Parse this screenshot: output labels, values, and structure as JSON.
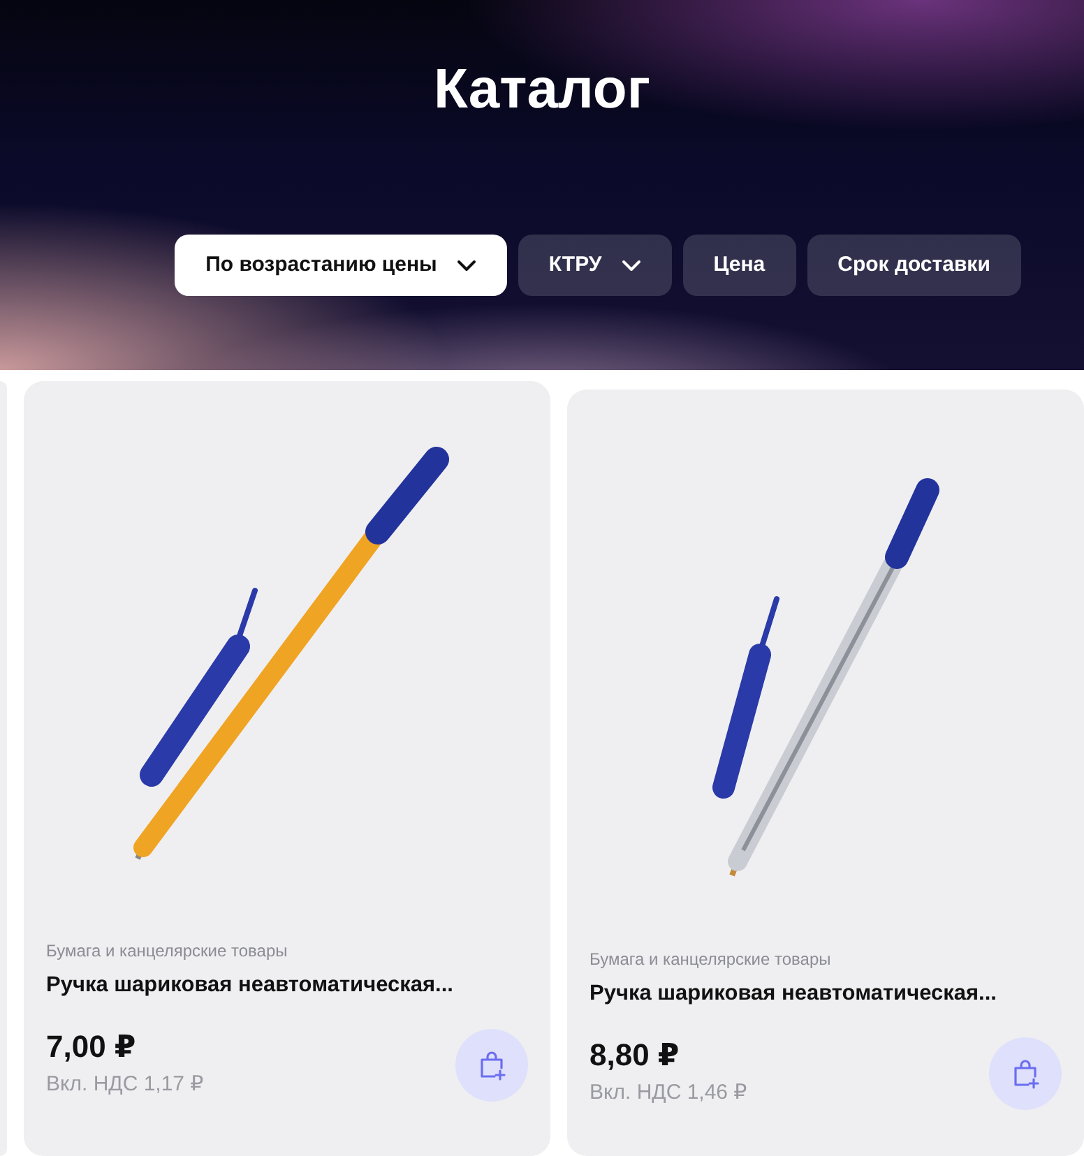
{
  "header": {
    "title": "Каталог"
  },
  "filters": [
    {
      "kind": "sort",
      "label": "По возрастанию цены",
      "has_dropdown": true
    },
    {
      "kind": "filter",
      "label": "КТРУ",
      "has_dropdown": true
    },
    {
      "kind": "filter",
      "label": "Цена",
      "has_dropdown": false
    },
    {
      "kind": "filter",
      "label": "Срок доставки",
      "has_dropdown": false
    }
  ],
  "products": [
    {
      "kind": "orange-pen",
      "category": "Бумага и канцелярские товары",
      "title": "Ручка шариковая неавтоматическая...",
      "price": "7,00 ₽",
      "vat": "Вкл. НДС 1,17 ₽"
    },
    {
      "kind": "clear-pen",
      "category": "Бумага и канцелярские товары",
      "title": "Ручка шариковая неавтоматическая...",
      "price": "8,80 ₽",
      "vat": "Вкл. НДС 1,46 ₽"
    }
  ]
}
